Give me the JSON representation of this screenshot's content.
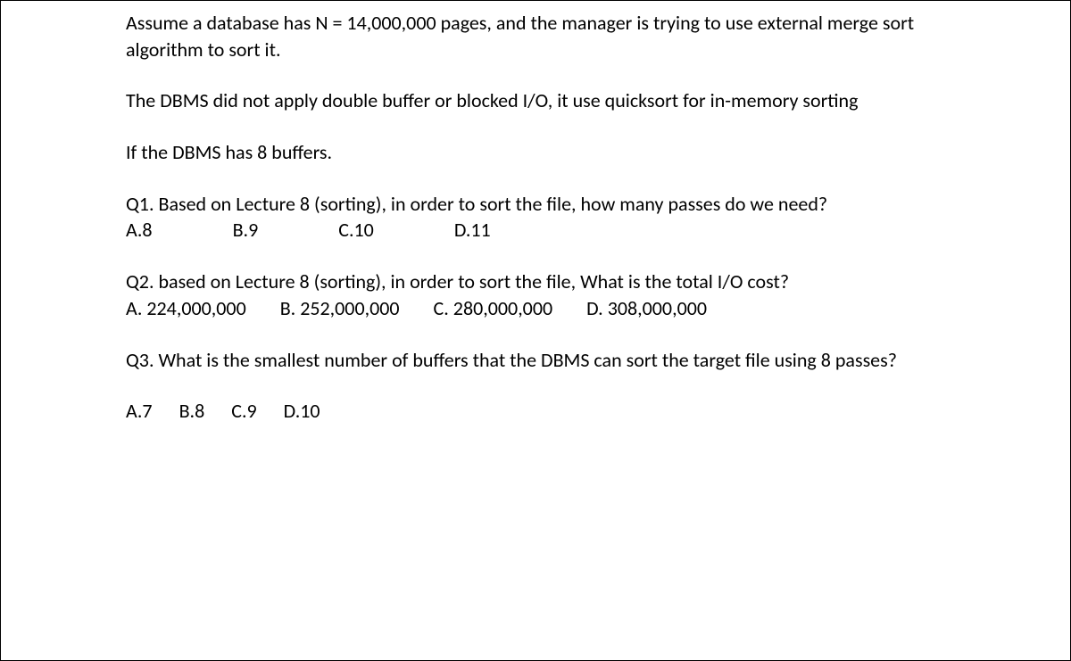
{
  "intro": {
    "p1": "Assume a database has N = 14,000,000 pages, and the manager is trying to use external merge sort algorithm to sort it.",
    "p2": "The DBMS did not apply double buffer or blocked I/O, it use quicksort for in-memory sorting",
    "p3": "If the DBMS has 8 buffers."
  },
  "q1": {
    "text": "Q1. Based on  Lecture 8 (sorting), in order to sort  the file, how many passes do we need?",
    "options": [
      "A.8",
      "B.9",
      "C.10",
      "D.11"
    ]
  },
  "q2": {
    "text": "Q2. based on Lecture 8 (sorting), in order to sort the file, What is the total I/O cost?",
    "options": [
      "A. 224,000,000",
      "B. 252,000,000",
      "C. 280,000,000",
      "D. 308,000,000"
    ]
  },
  "q3": {
    "text": "Q3. What is the smallest number of buffers that the DBMS can sort the target file using 8 passes?",
    "options": [
      "A.7",
      "B.8",
      "C.9",
      "D.10"
    ]
  }
}
